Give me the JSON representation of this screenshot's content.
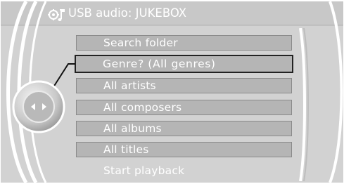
{
  "header": {
    "title": "USB audio: JUKEBOX",
    "icon": "music-settings-icon"
  },
  "menu": {
    "items": [
      {
        "label": "Search folder",
        "selected": false,
        "style": "bar"
      },
      {
        "label": "Genre? (All genres)",
        "selected": true,
        "style": "bar"
      },
      {
        "label": "All artists",
        "selected": false,
        "style": "bar"
      },
      {
        "label": "All composers",
        "selected": false,
        "style": "bar"
      },
      {
        "label": "All albums",
        "selected": false,
        "style": "bar"
      },
      {
        "label": "All titles",
        "selected": false,
        "style": "bar"
      },
      {
        "label": "Start playback",
        "selected": false,
        "style": "plain"
      }
    ]
  },
  "controller": {
    "icon": "controller-knob-icon",
    "left_arrow": "left-arrow-icon",
    "right_arrow": "right-arrow-icon"
  },
  "colors": {
    "background": "#d2d2d2",
    "item_bar": "#b5b5b5",
    "selection_border": "#222222",
    "text": "#ffffff"
  }
}
